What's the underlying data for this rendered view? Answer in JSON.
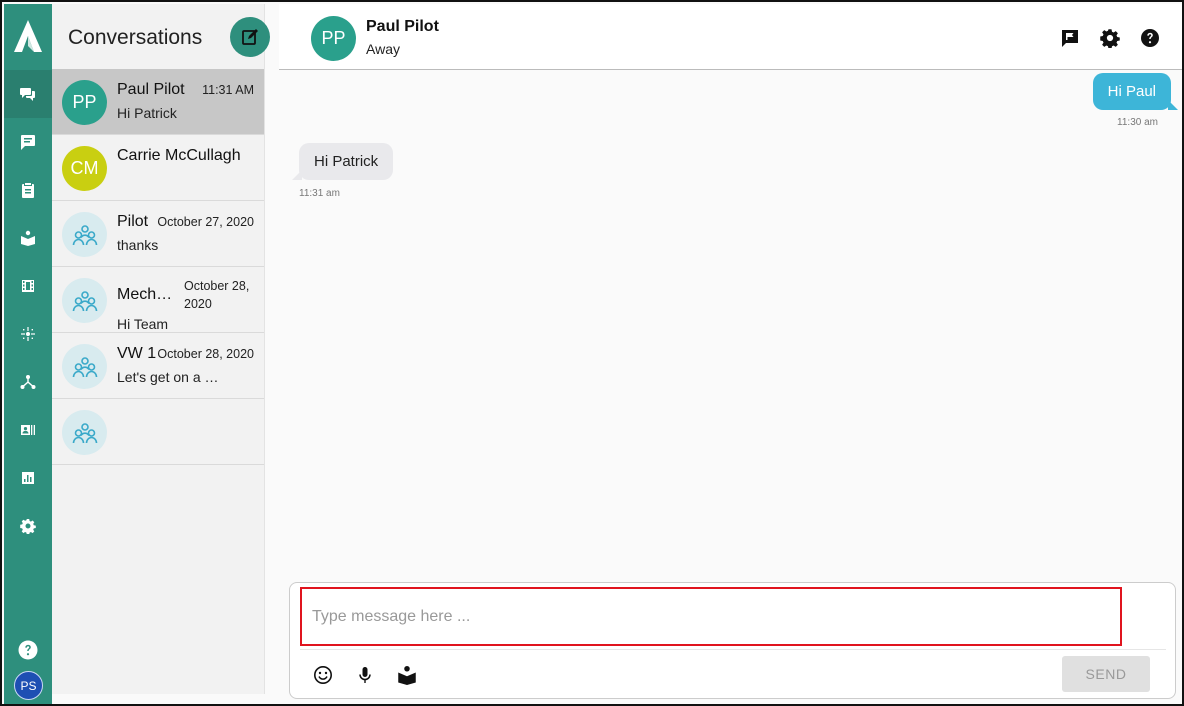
{
  "sidebar": {
    "user_initials": "PS",
    "nav_items": [
      {
        "icon": "chat-bubbles-icon",
        "active": true
      },
      {
        "icon": "message-icon",
        "active": false
      },
      {
        "icon": "clipboard-icon",
        "active": false
      },
      {
        "icon": "book-icon",
        "active": false
      },
      {
        "icon": "film-icon",
        "active": false
      },
      {
        "icon": "hub-icon",
        "active": false
      },
      {
        "icon": "network-icon",
        "active": false
      },
      {
        "icon": "contact-card-icon",
        "active": false
      },
      {
        "icon": "bar-chart-icon",
        "active": false
      },
      {
        "icon": "gear-icon",
        "active": false
      }
    ],
    "accent_color": "#2e8f7d"
  },
  "conversations": {
    "title": "Conversations",
    "items": [
      {
        "initials": "PP",
        "name": "Paul Pilot",
        "time": "11:31 AM",
        "preview": "Hi Patrick",
        "avatar": "teal",
        "active": true
      },
      {
        "initials": "CM",
        "name": "Carrie McCullagh",
        "time": "",
        "preview": "",
        "avatar": "lime",
        "active": false
      },
      {
        "initials": "",
        "name": "Pilot",
        "time": "October 27, 2020",
        "preview": "thanks",
        "avatar": "group",
        "active": false
      },
      {
        "initials": "",
        "name": "Mech…",
        "time": "October 28, 2020",
        "preview": "Hi Team",
        "avatar": "group",
        "active": false
      },
      {
        "initials": "",
        "name": "VW 1",
        "time": "October 28, 2020",
        "preview": "Let's get on a …",
        "avatar": "group",
        "active": false
      },
      {
        "initials": "",
        "name": "",
        "time": "",
        "preview": "",
        "avatar": "group",
        "active": false
      }
    ]
  },
  "chat": {
    "contact_initials": "PP",
    "contact_name": "Paul Pilot",
    "contact_status": "Away",
    "messages": [
      {
        "direction": "out",
        "text": "Hi Paul",
        "time": "11:30 am"
      },
      {
        "direction": "in",
        "text": "Hi Patrick",
        "time": "11:31 am"
      }
    ]
  },
  "composer": {
    "placeholder": "Type message here ...",
    "value": "",
    "send_label": "SEND"
  },
  "colors": {
    "outgoing_bubble": "#3db5d8",
    "incoming_bubble": "#e9e9ec",
    "input_highlight": "#e0141e"
  }
}
